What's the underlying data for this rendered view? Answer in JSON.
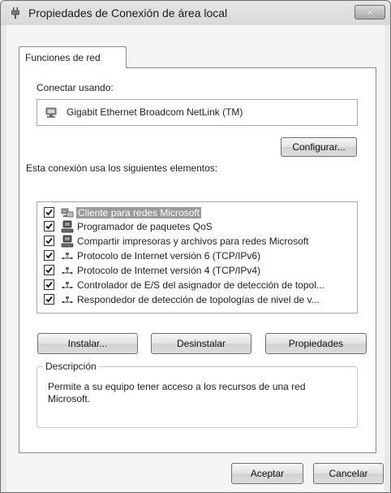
{
  "window": {
    "title": "Propiedades de Conexión de área local",
    "close_glyph": "✕"
  },
  "tab": {
    "label": "Funciones de red"
  },
  "connect_using": {
    "label": "Conectar usando:",
    "adapter": "Gigabit Ethernet Broadcom NetLink (TM)",
    "adapter_icon": "network-adapter-icon"
  },
  "configure_button": "Configurar...",
  "items_label": "Esta conexión usa los siguientes elementos:",
  "items": [
    {
      "label": "Cliente para redes Microsoft",
      "checked": true,
      "selected": true,
      "icon": "network-client-icon"
    },
    {
      "label": "Programador de paquetes QoS",
      "checked": true,
      "selected": false,
      "icon": "computer-service-icon"
    },
    {
      "label": "Compartir impresoras y archivos para redes Microsoft",
      "checked": true,
      "selected": false,
      "icon": "computer-service-icon"
    },
    {
      "label": "Protocolo de Internet versión 6 (TCP/IPv6)",
      "checked": true,
      "selected": false,
      "icon": "protocol-icon"
    },
    {
      "label": "Protocolo de Internet versión 4 (TCP/IPv4)",
      "checked": true,
      "selected": false,
      "icon": "protocol-icon"
    },
    {
      "label": "Controlador de E/S del asignador de detección de topol...",
      "checked": true,
      "selected": false,
      "icon": "protocol-icon"
    },
    {
      "label": "Respondedor de detección de topologías de nivel de v...",
      "checked": true,
      "selected": false,
      "icon": "protocol-icon"
    }
  ],
  "buttons": {
    "install": "Instalar...",
    "uninstall": "Desinstalar",
    "properties": "Propiedades",
    "ok": "Aceptar",
    "cancel": "Cancelar"
  },
  "description": {
    "legend": "Descripción",
    "text": "Permite a su equipo tener acceso a los recursos de una red Microsoft."
  }
}
